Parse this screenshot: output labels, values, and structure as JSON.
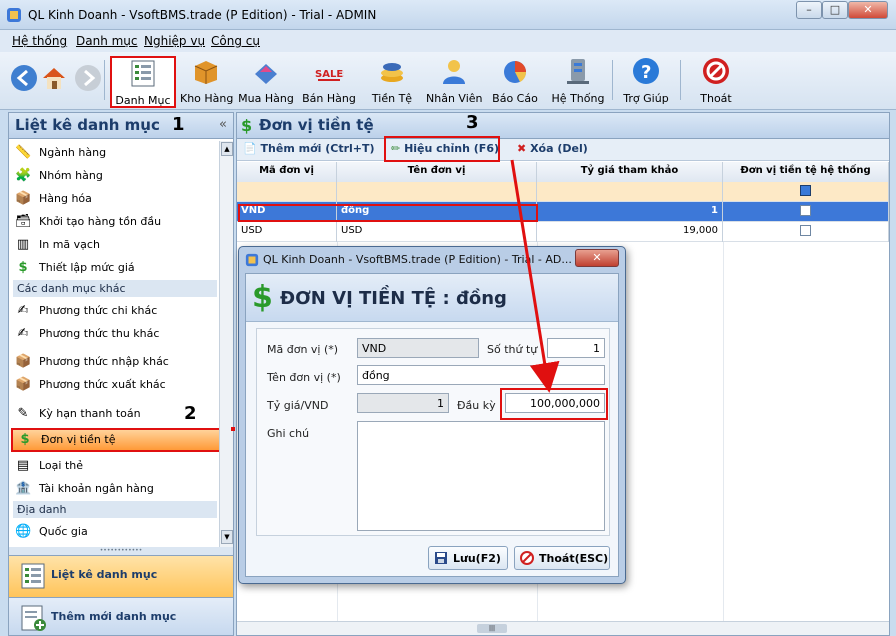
{
  "window": {
    "title": "QL Kinh Doanh - VsoftBMS.trade (P Edition) - Trial - ADMIN"
  },
  "menu": [
    "Hệ thống",
    "Danh mục",
    "Nghiệp vụ",
    "Công cụ"
  ],
  "toolbar": [
    {
      "label": "Danh Mục",
      "icon": "list-icon"
    },
    {
      "label": "Kho Hàng",
      "icon": "box-icon"
    },
    {
      "label": "Mua Hàng",
      "icon": "purchase-icon"
    },
    {
      "label": "Bán Hàng",
      "icon": "sales-icon"
    },
    {
      "label": "Tiền Tệ",
      "icon": "coins-icon"
    },
    {
      "label": "Nhân Viên",
      "icon": "person-icon"
    },
    {
      "label": "Báo Cáo",
      "icon": "report-icon"
    },
    {
      "label": "Hệ Thống",
      "icon": "system-icon"
    },
    {
      "label": "Trợ Giúp",
      "icon": "help-icon"
    },
    {
      "label": "Thoát",
      "icon": "exit-icon"
    }
  ],
  "sidebar": {
    "title": "Liệt kê danh mục",
    "items": [
      "Ngành hàng",
      "Nhóm hàng",
      "Hàng hóa",
      "Khởi tạo hàng tồn đầu",
      "In mã vạch",
      "Thiết lập mức giá",
      "Các danh mục khác",
      "Phương thức chi khác",
      "Phương thức thu khác",
      "Phương thức nhập khác",
      "Phương thức xuất khác",
      "Kỳ hạn thanh toán",
      "Đơn vị tiền tệ",
      "Loại thẻ",
      "Tài khoản ngân hàng",
      "Địa danh",
      "Quốc gia"
    ],
    "bottom": [
      "Liệt kê danh mục",
      "Thêm mới danh mục"
    ]
  },
  "main": {
    "title": "Đơn vị tiền tệ",
    "actions": [
      "Thêm mới (Ctrl+T)",
      "Hiệu chỉnh (F6)",
      "Xóa (Del)"
    ],
    "columns": [
      "Mã đơn vị",
      "Tên đơn vị",
      "Tỷ giá tham khảo",
      "Đơn vị tiền tệ hệ thống"
    ],
    "rows": [
      {
        "code": "VND",
        "name": "đồng",
        "rate": "1",
        "system": true
      },
      {
        "code": "USD",
        "name": "USD",
        "rate": "19,000",
        "system": false
      }
    ]
  },
  "dialog": {
    "title": "QL Kinh Doanh - VsoftBMS.trade (P Edition) - Trial - AD...",
    "heading": "ĐƠN VỊ TIỀN TỆ : đồng",
    "fields": {
      "code_label": "Mã đơn vị (*)",
      "code": "VND",
      "order_label": "Số thứ tự",
      "order": "1",
      "name_label": "Tên đơn vị (*)",
      "name": "đồng",
      "rate_label": "Tỷ giá/VND",
      "rate": "1",
      "start_label": "Đầu kỳ",
      "start": "100,000,000",
      "note_label": "Ghi chú",
      "note": ""
    },
    "save": "Lưu(F2)",
    "close": "Thoát(ESC)"
  },
  "annotations": [
    "1",
    "2",
    "3"
  ],
  "colors": {
    "selected_row": "#3d78d8",
    "highlight": "#e01010",
    "money_green": "#2a9a2a"
  }
}
